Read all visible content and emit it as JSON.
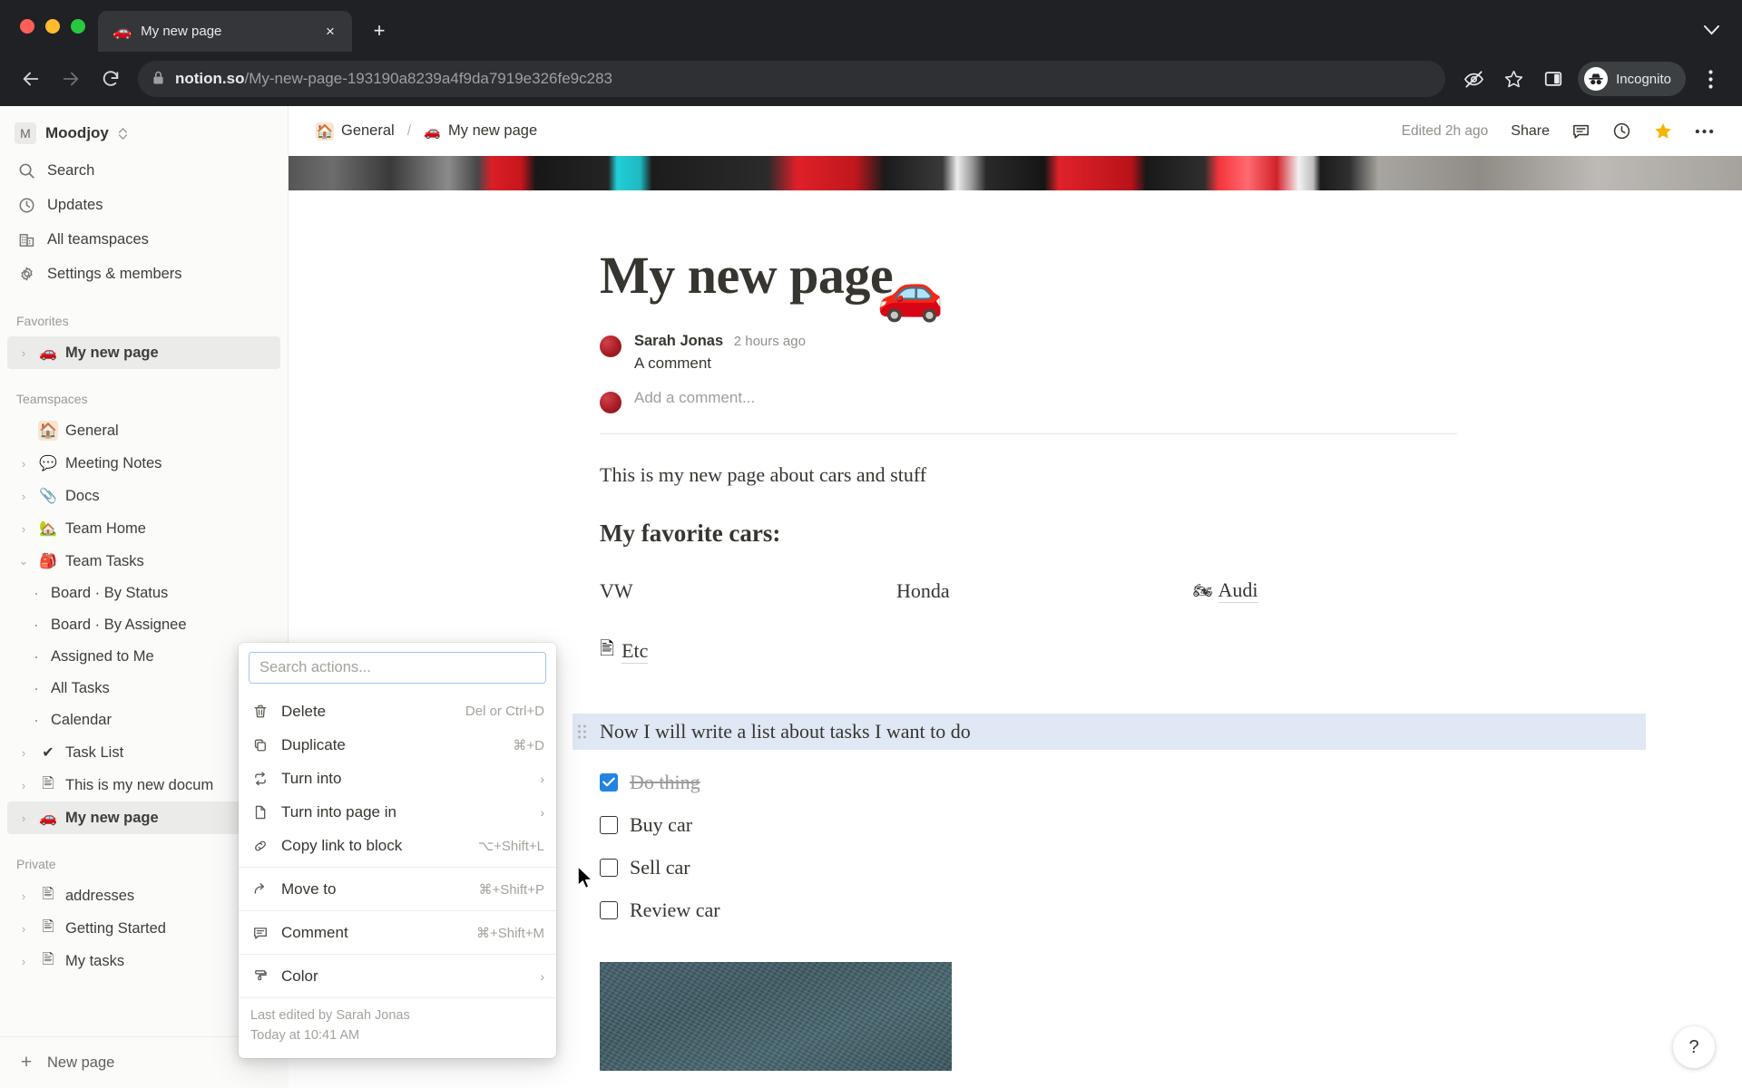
{
  "browser": {
    "tab": {
      "title": "My new page",
      "favicon": "car-emoji",
      "close_label": "×"
    },
    "new_tab_label": "+",
    "tab_list_chevron": "∨",
    "back_label": "←",
    "forward_label": "→",
    "reload_label": "↻",
    "lock_icon": "lock-icon",
    "url_domain": "notion.so",
    "url_path": "/My-new-page-193190a8239a4f9da7919e326fe9c283",
    "extensions_icon": "eye-off-icon",
    "bookmark_icon": "star-outline-icon",
    "sidepanel_icon": "side-panel-icon",
    "profile_label": "Incognito",
    "menu_icon": "kebab-menu-icon"
  },
  "sidebar": {
    "workspace": {
      "initial": "M",
      "name": "Moodjoy"
    },
    "nav": [
      {
        "label": "Search",
        "icon": "search-icon"
      },
      {
        "label": "Updates",
        "icon": "clock-icon"
      },
      {
        "label": "All teamspaces",
        "icon": "building-icon"
      },
      {
        "label": "Settings & members",
        "icon": "gear-icon"
      }
    ],
    "favorites_label": "Favorites",
    "favorites": [
      {
        "label": "My new page",
        "emoji": "🚗",
        "active": true
      }
    ],
    "teamspaces_label": "Teamspaces",
    "teamspaces": [
      {
        "label": "General",
        "emoji": "🏠",
        "boxed": true,
        "twisty": ""
      },
      {
        "label": "Meeting Notes",
        "emoji": "💬",
        "twisty": "›"
      },
      {
        "label": "Docs",
        "emoji": "📎",
        "twisty": "›"
      },
      {
        "label": "Team Home",
        "emoji": "🏡",
        "twisty": "›"
      },
      {
        "label": "Team Tasks",
        "emoji": "🎒",
        "twisty": "⌄",
        "expanded": true
      }
    ],
    "team_tasks_children": [
      "Board · By Status",
      "Board · By Assignee",
      "Assigned to Me",
      "All Tasks",
      "Calendar"
    ],
    "teamspaces_tail": [
      {
        "label": "Task List",
        "emoji": "✔️",
        "twisty": "›"
      },
      {
        "label": "This is my new docum",
        "emoji": "📄",
        "twisty": "›"
      },
      {
        "label": "My new page",
        "emoji": "🚗",
        "twisty": "›",
        "active": true
      }
    ],
    "private_label": "Private",
    "private": [
      {
        "label": "addresses",
        "emoji": "📄",
        "twisty": "›"
      },
      {
        "label": "Getting Started",
        "emoji": "📄",
        "twisty": "›"
      },
      {
        "label": "My tasks",
        "emoji": "📄",
        "twisty": "›"
      }
    ],
    "new_page_label": "New page"
  },
  "topbar": {
    "crumb_team": "General",
    "crumb_team_emoji": "🏠",
    "separator": "/",
    "crumb_page": "My new page",
    "crumb_page_emoji": "🚗",
    "edited": "Edited 2h ago",
    "share_label": "Share",
    "comment_icon": "comment-icon",
    "history_icon": "clock-icon",
    "favorite_icon": "star-filled-icon",
    "more_icon": "ellipsis-icon"
  },
  "document": {
    "page_emoji": "🚗",
    "title": "My new page",
    "comment": {
      "author": "Sarah Jonas",
      "time": "2 hours ago",
      "text": "A comment",
      "add_placeholder": "Add a comment..."
    },
    "paragraph": "This is my new page about cars and stuff",
    "heading": "My favorite cars:",
    "columns": [
      {
        "text": "VW",
        "emoji": ""
      },
      {
        "text": "Honda",
        "emoji": ""
      },
      {
        "text": "Audi",
        "emoji": "🏍️"
      }
    ],
    "etc": {
      "emoji": "📄",
      "text": "Etc"
    },
    "highlighted_block": "Now I will write a list about tasks I want to do",
    "todos": [
      {
        "label": "Do thing",
        "checked": true
      },
      {
        "label": "Buy car",
        "checked": false
      },
      {
        "label": "Sell car",
        "checked": false
      },
      {
        "label": "Review car",
        "checked": false
      }
    ],
    "help_label": "?"
  },
  "context_menu": {
    "search_placeholder": "Search actions...",
    "group1": [
      {
        "label": "Delete",
        "shortcut": "Del or Ctrl+D",
        "icon": "trash-icon",
        "arrow": ""
      },
      {
        "label": "Duplicate",
        "shortcut": "⌘+D",
        "icon": "duplicate-icon",
        "arrow": ""
      },
      {
        "label": "Turn into",
        "shortcut": "",
        "icon": "turn-into-icon",
        "arrow": "›"
      },
      {
        "label": "Turn into page in",
        "shortcut": "",
        "icon": "page-icon",
        "arrow": "›"
      },
      {
        "label": "Copy link to block",
        "shortcut": "⌥+Shift+L",
        "icon": "link-icon",
        "arrow": ""
      }
    ],
    "group2": [
      {
        "label": "Move to",
        "shortcut": "⌘+Shift+P",
        "icon": "arrow-right-icon",
        "arrow": ""
      }
    ],
    "group3": [
      {
        "label": "Comment",
        "shortcut": "⌘+Shift+M",
        "icon": "comment-icon",
        "arrow": ""
      }
    ],
    "group4": [
      {
        "label": "Color",
        "shortcut": "",
        "icon": "paint-roller-icon",
        "arrow": "›"
      }
    ],
    "footer_line1": "Last edited by Sarah Jonas",
    "footer_line2": "Today at 10:41 AM"
  },
  "colors": {
    "accent": "#2383e2",
    "highlight": "#dfe8f4",
    "chrome_bg": "#202124",
    "star": "#f5b400"
  }
}
